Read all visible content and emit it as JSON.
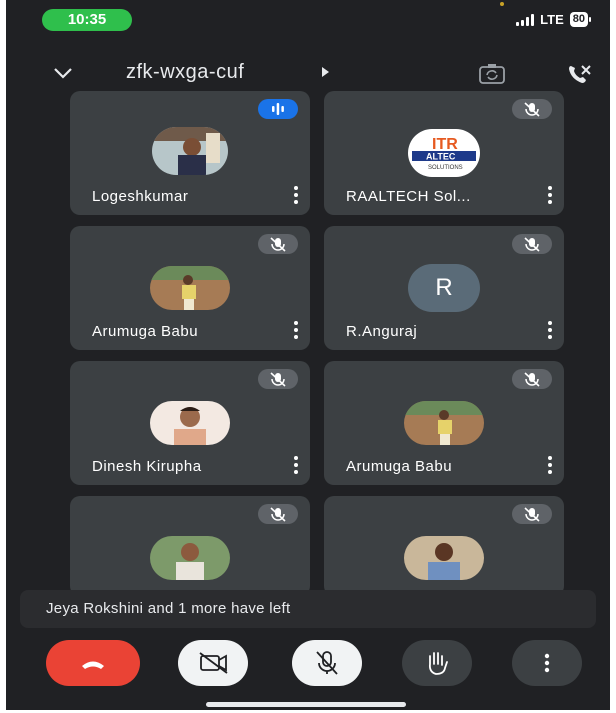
{
  "status_bar": {
    "time": "10:35",
    "network": "LTE",
    "battery": "80"
  },
  "header": {
    "meeting_code": "zfk-wxga-cuf"
  },
  "participants": [
    {
      "name": "Logeshkumar",
      "mic": "speaking"
    },
    {
      "name": "RAALTECH Sol...",
      "mic": "muted",
      "logo_text": "ITR ALTEC SOLUTIONS"
    },
    {
      "name": "Arumuga Babu",
      "mic": "muted"
    },
    {
      "name": "R.Anguraj",
      "mic": "muted",
      "initial": "R"
    },
    {
      "name": "Dinesh Kirupha",
      "mic": "muted"
    },
    {
      "name": "Arumuga Babu",
      "mic": "muted"
    },
    {
      "name": "",
      "mic": "muted"
    },
    {
      "name": "",
      "mic": "muted"
    }
  ],
  "toast": {
    "message": "Jeya Rokshini and 1 more have left"
  },
  "controls": {
    "end_call": "end-call-icon",
    "video": "video-off-icon",
    "mic": "mic-off-icon",
    "hand": "raise-hand-icon",
    "more": "more-vert-icon"
  },
  "colors": {
    "background": "#202124",
    "tile": "#3c4043",
    "end_call": "#ea4335",
    "speaking": "#1a73e8",
    "time_pill": "#2fbf4c"
  }
}
